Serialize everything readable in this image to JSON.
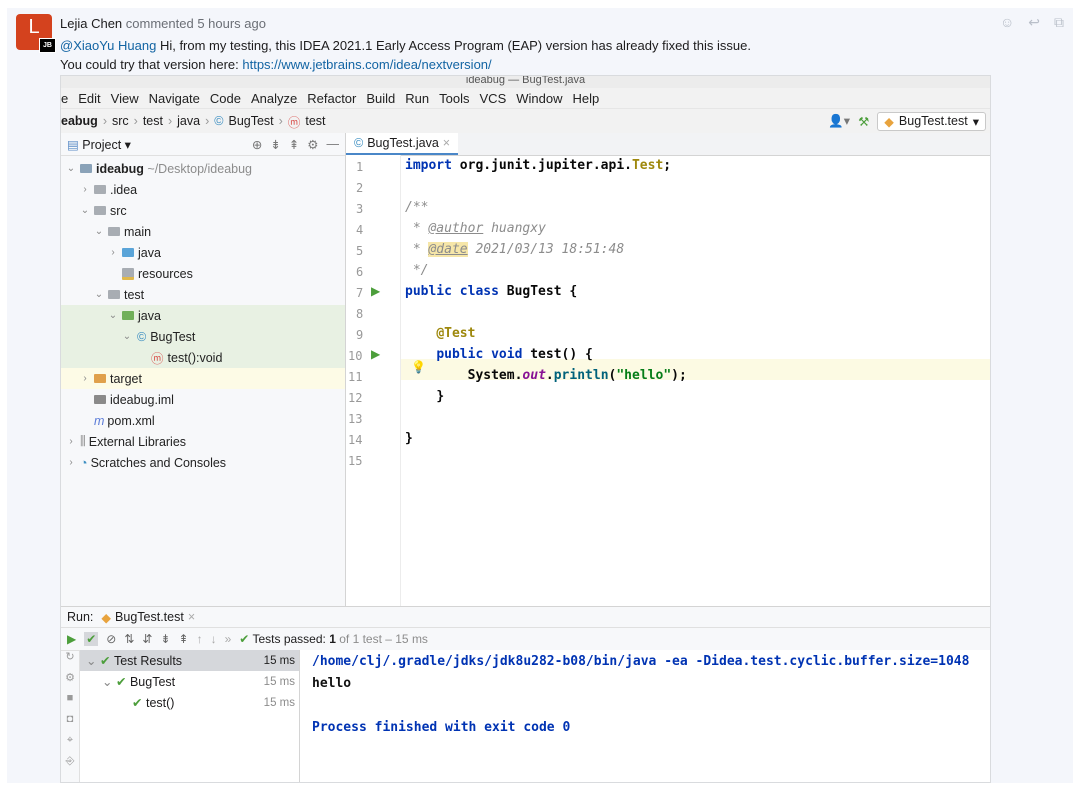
{
  "comment": {
    "avatar_letter": "L",
    "badge": "JB",
    "author": "Lejia Chen",
    "meta": "commented 5 hours ago",
    "mention": "@XiaoYu Huang",
    "line1_text": " Hi, from my testing, this IDEA 2021.1 Early Access Program (EAP) version has already fixed this issue.",
    "line2_text": "You could try that version here: ",
    "link": "https://www.jetbrains.com/idea/nextversion/"
  },
  "ide": {
    "window_title": "ideabug — BugTest.java",
    "menu": [
      "e",
      "Edit",
      "View",
      "Navigate",
      "Code",
      "Analyze",
      "Refactor",
      "Build",
      "Run",
      "Tools",
      "VCS",
      "Window",
      "Help"
    ],
    "breadcrumbs": [
      "eabug",
      "src",
      "test",
      "java",
      "BugTest",
      "test"
    ],
    "run_config": "BugTest.test",
    "project_label": "Project",
    "tree": [
      {
        "label": "ideabug",
        "extra": "~/Desktop/ideabug"
      },
      {
        "label": ".idea"
      },
      {
        "label": "src"
      },
      {
        "label": "main"
      },
      {
        "label": "java"
      },
      {
        "label": "resources"
      },
      {
        "label": "test"
      },
      {
        "label": "java"
      },
      {
        "label": "BugTest"
      },
      {
        "label": "test():void"
      },
      {
        "label": "target"
      },
      {
        "label": "ideabug.iml"
      },
      {
        "label": "pom.xml"
      },
      {
        "label": "External Libraries"
      },
      {
        "label": "Scratches and Consoles"
      }
    ],
    "editor_tab": "BugTest.java",
    "line_numbers": [
      "1",
      "2",
      "3",
      "4",
      "5",
      "6",
      "7",
      "8",
      "9",
      "10",
      "11",
      "12",
      "13",
      "14",
      "15"
    ],
    "code": {
      "l1_kw": "import",
      "l1_rest": " org.junit.jupiter.api.",
      "l1_cls": "Test",
      "l3": "/**",
      "l4_pre": " * ",
      "l4_tag": "@author",
      "l4_val": " huangxy",
      "l5_pre": " * ",
      "l5_tag": "@date",
      "l5_val": " 2021/03/13 18:51:48",
      "l6": " */",
      "l7_kw": "public class",
      "l7_name": " BugTest {",
      "l9": "@Test",
      "l10_kw": "public void",
      "l10_name": " test() {",
      "l11_a": "System.",
      "l11_out": "out",
      "l11_b": ".",
      "l11_fn": "println",
      "l11_str": "\"hello\"",
      "l11_c": ");",
      "l12": "}",
      "l14": "}"
    },
    "run": {
      "label": "Run:",
      "tab": "BugTest.test",
      "status_prefix": "Tests passed: ",
      "status_count": "1",
      "status_rest": " of 1 test – 15 ms",
      "results": [
        {
          "label": "Test Results",
          "time": "15 ms"
        },
        {
          "label": "BugTest",
          "time": "15 ms"
        },
        {
          "label": "test()",
          "time": "15 ms"
        }
      ],
      "console": [
        "/home/clj/.gradle/jdks/jdk8u282-b08/bin/java -ea -Didea.test.cyclic.buffer.size=1048",
        "hello",
        "",
        "Process finished with exit code 0"
      ]
    }
  }
}
